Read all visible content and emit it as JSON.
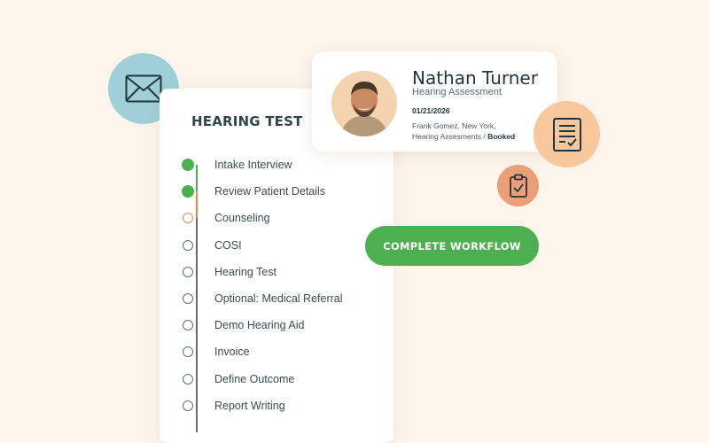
{
  "panel": {
    "title": "HEARING TEST",
    "steps": [
      {
        "label": "Intake Interview",
        "status": "done"
      },
      {
        "label": "Review Patient Details",
        "status": "done"
      },
      {
        "label": "Counseling",
        "status": "current"
      },
      {
        "label": "COSI",
        "status": "pending"
      },
      {
        "label": "Hearing Test",
        "status": "pending"
      },
      {
        "label": "Optional: Medical Referral",
        "status": "pending"
      },
      {
        "label": "Demo Hearing Aid",
        "status": "pending"
      },
      {
        "label": "Invoice",
        "status": "pending"
      },
      {
        "label": "Define Outcome",
        "status": "pending"
      },
      {
        "label": "Report Writing",
        "status": "pending"
      }
    ]
  },
  "patient_card": {
    "name": "Nathan Turner",
    "subtitle": "Hearing Assessment",
    "date": "01/21/2026",
    "location_line1": "Frank Gomez, New York,",
    "location_line2": "Hearing Assesments /",
    "status": "Booked"
  },
  "cta": {
    "label": "COMPLETE WORKFLOW"
  },
  "icons": {
    "mail": "mail-icon",
    "document": "document-check-icon",
    "clipboard": "clipboard-check-icon"
  },
  "colors": {
    "background": "#fdf5ec",
    "done": "#4caf50",
    "current": "#e8884a",
    "pending": "#5e6f78",
    "mail_circle": "#9fcfd8",
    "doc_circle": "#f8c89c",
    "clip_circle": "#ec9e77"
  }
}
